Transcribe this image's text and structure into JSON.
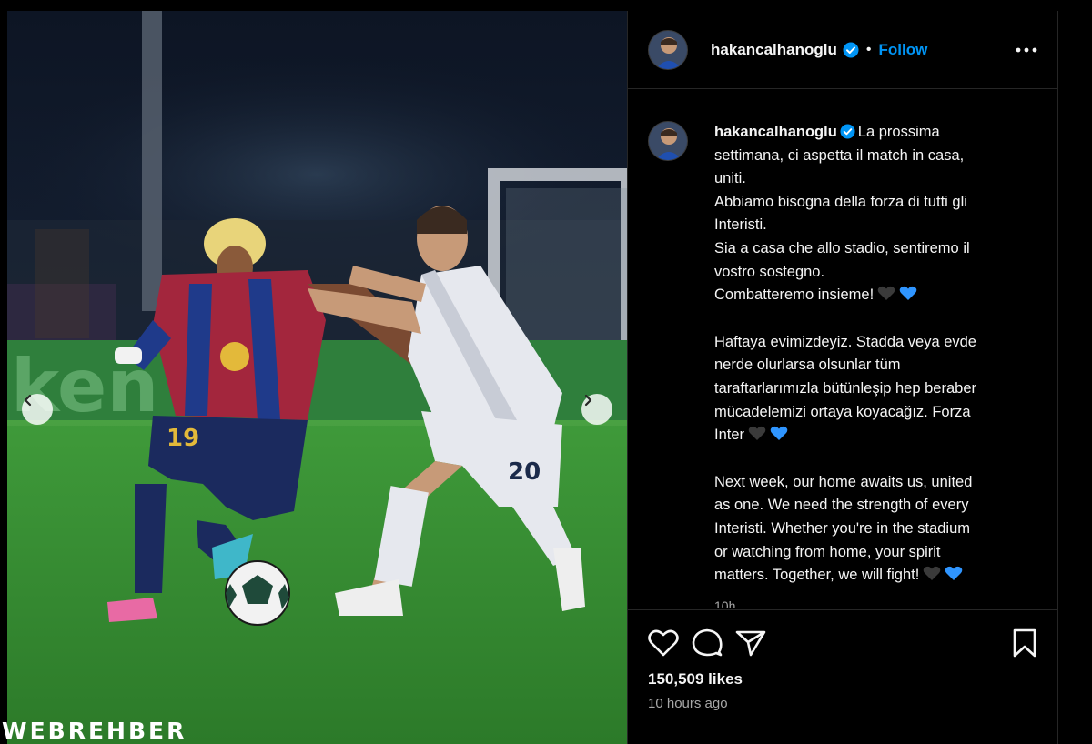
{
  "post": {
    "username": "hakancalhanoglu",
    "follow_label": "Follow",
    "separator": "•",
    "caption": {
      "lines_it": "La prossima\nsettimana, ci aspetta il match in casa,\nuniti.\nAbbiamo bisogna della forza di tutti gli\nInteristi.\nSia a casa che allo stadio, sentiremo il\nvostro sostegno.\nCombatteremo insieme!",
      "lines_tr": "Haftaya evimizdeyiz. Stadda veya evde\nnerde olurlarsa olsunlar tüm\ntaraftarlarımızla bütünleşip hep beraber\nmücadelemizi ortaya koyacağız. Forza\nInter",
      "lines_en": "Next week, our home awaits us, united\nas one. We need the strength of every\nInteristi. Whether you're in the stadium\nor watching from home, your spirit\nmatters. Together, we will fight!"
    },
    "caption_time": "10h",
    "likes": "150,509 likes",
    "posted_ago": "10 hours ago"
  },
  "media": {
    "watermark": "WEBREHBER",
    "jersey_19": "19",
    "jersey_20": "20",
    "board_text": "ken"
  },
  "icons": {
    "heart": "heart-icon",
    "comment": "comment-icon",
    "share": "share-icon",
    "bookmark": "bookmark-icon",
    "more": "more-icon",
    "verified": "verified-badge-icon",
    "prev": "chevron-left-icon",
    "next": "chevron-right-icon"
  },
  "colors": {
    "follow": "#0095f6",
    "verified": "#0095f6",
    "heart_blue": "#2f95ff",
    "heart_black": "#3a3a3a"
  }
}
